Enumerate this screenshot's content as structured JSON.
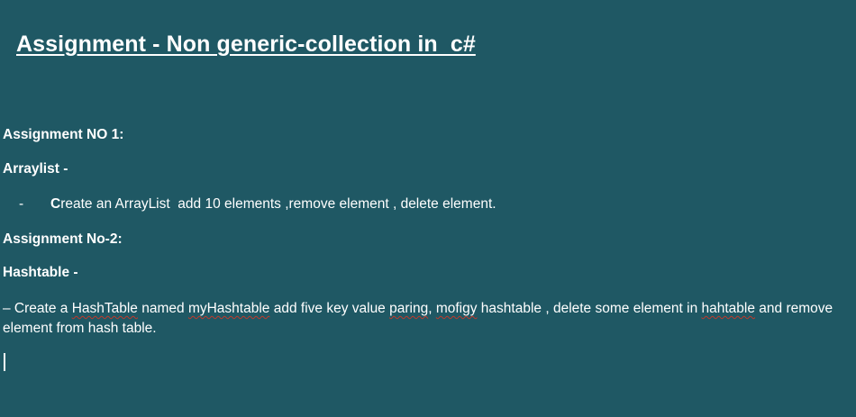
{
  "title": "Assignment - Non generic-collection in  c#",
  "assignment1": {
    "heading": "Assignment NO 1:",
    "topic": "Arraylist -",
    "bullet_marker": "-",
    "bullet_first_letter": "C",
    "bullet_rest": "reate an ArrayList  add 10 elements ,remove element , delete element."
  },
  "assignment2": {
    "heading": "Assignment No-2:",
    "topic": "Hashtable -",
    "p_1": "– Create a ",
    "w_hashtable": "HashTable",
    "p_2": " named ",
    "w_myhashtable": "myHashtable",
    "p_3": " add five key value ",
    "w_paring": "paring",
    "p_4": ", ",
    "w_mofigy": "mofigy",
    "p_5": " hashtable , delete some element in ",
    "w_hahtable": "hahtable",
    "p_6": " and remove element from hash table."
  }
}
